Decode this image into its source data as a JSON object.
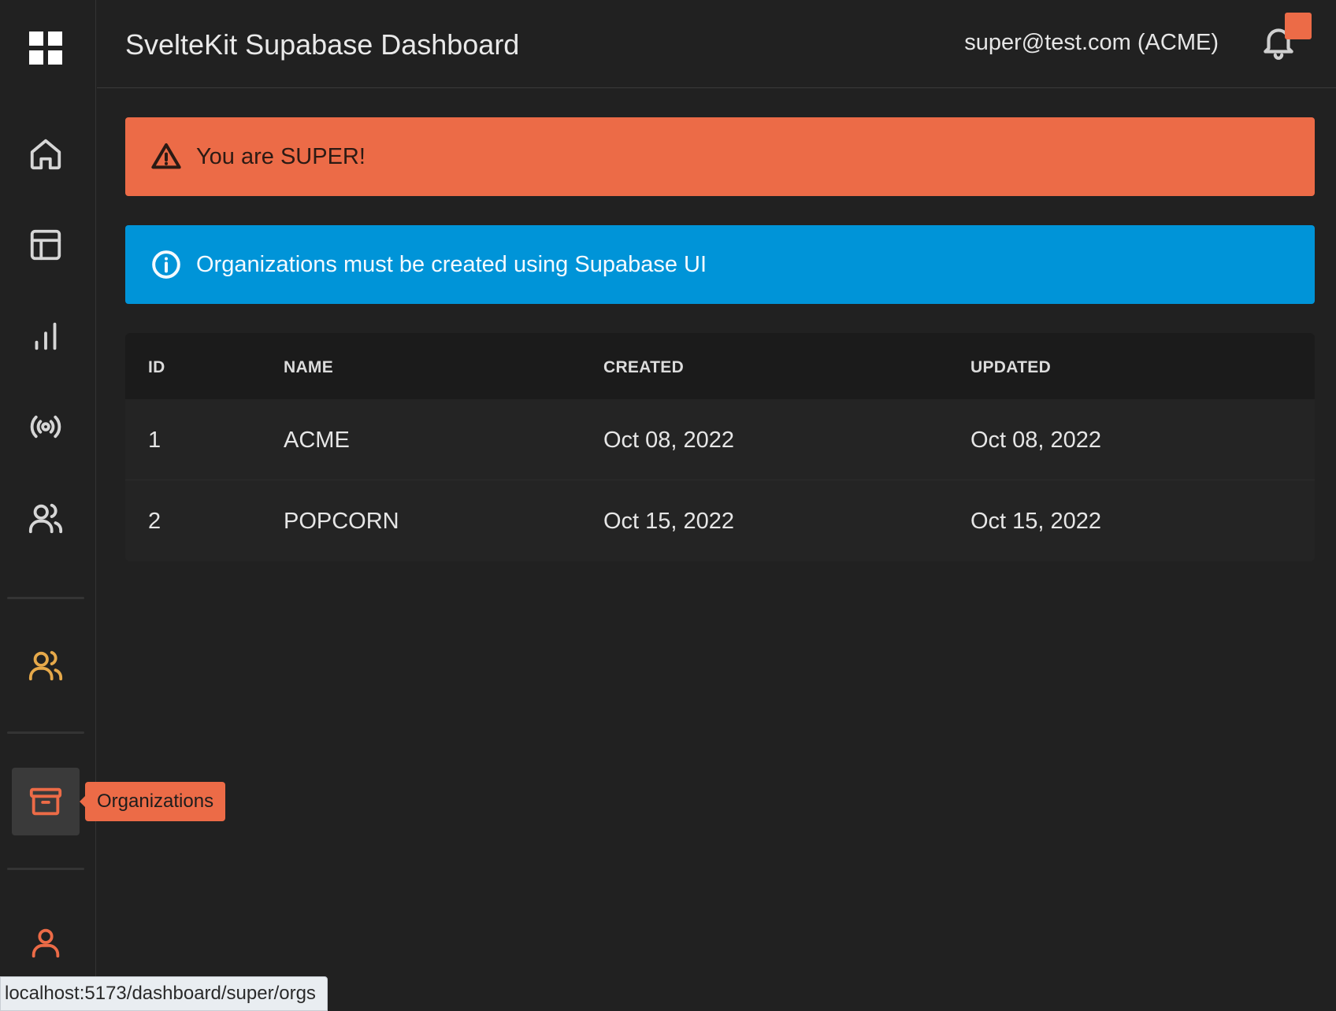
{
  "header": {
    "title": "SvelteKit Supabase Dashboard",
    "user": "super@test.com (ACME)"
  },
  "sidebar": {
    "items": [
      {
        "name": "home",
        "icon": "home-icon"
      },
      {
        "name": "layout",
        "icon": "layout-icon"
      },
      {
        "name": "stats",
        "icon": "bar-chart-icon"
      },
      {
        "name": "broadcast",
        "icon": "broadcast-icon"
      },
      {
        "name": "users",
        "icon": "users-icon"
      },
      {
        "name": "team",
        "icon": "users-icon"
      },
      {
        "name": "organizations",
        "icon": "archive-icon"
      },
      {
        "name": "profile",
        "icon": "user-icon"
      }
    ],
    "tooltip": "Organizations"
  },
  "alerts": {
    "warning": "You are SUPER!",
    "info": "Organizations must be created using Supabase UI"
  },
  "table": {
    "headers": [
      "ID",
      "NAME",
      "CREATED",
      "UPDATED"
    ],
    "rows": [
      {
        "id": "1",
        "name": "ACME",
        "created": "Oct 08, 2022",
        "updated": "Oct 08, 2022"
      },
      {
        "id": "2",
        "name": "POPCORN",
        "created": "Oct 15, 2022",
        "updated": "Oct 15, 2022"
      }
    ]
  },
  "statusbar": {
    "url": "localhost:5173/dashboard/super/orgs"
  },
  "colors": {
    "accent": "#ec6b47",
    "info": "#0094d8",
    "gold": "#e6a94a",
    "background": "#212121"
  }
}
